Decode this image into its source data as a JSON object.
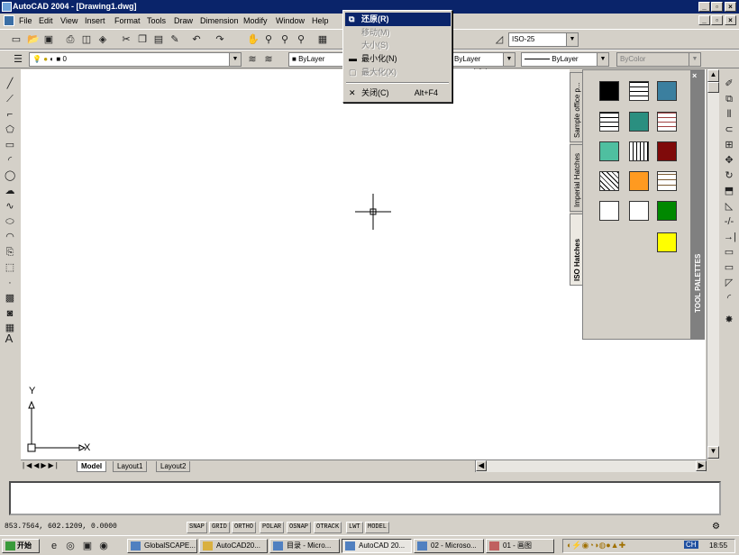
{
  "window": {
    "title": "AutoCAD 2004 - [Drawing1.dwg]"
  },
  "menubar": [
    "File",
    "Edit",
    "View",
    "Insert",
    "Format",
    "Tools",
    "Draw",
    "Dimension",
    "Modify",
    "Window",
    "Help"
  ],
  "toolbar": {
    "dimstyle_value": "ISO-25",
    "layer_value": "0",
    "color_value": "ByLayer",
    "linetype_value": "ByLayer",
    "lineweight_value": "ByLayer",
    "plotstyle_value": "ByColor"
  },
  "system_menu": {
    "items": [
      {
        "icon": "restore-icon",
        "label": "还原(R)",
        "shortcut": "",
        "state": "highlighted"
      },
      {
        "icon": "",
        "label": "移动(M)",
        "shortcut": "",
        "state": "disabled"
      },
      {
        "icon": "",
        "label": "大小(S)",
        "shortcut": "",
        "state": "disabled"
      },
      {
        "icon": "minimize-icon",
        "label": "最小化(N)",
        "shortcut": "",
        "state": "normal"
      },
      {
        "icon": "maximize-icon",
        "label": "最大化(X)",
        "shortcut": "",
        "state": "disabled"
      },
      {
        "icon": "close-icon",
        "label": "关闭(C)",
        "shortcut": "Alt+F4",
        "state": "normal"
      }
    ]
  },
  "tool_palette": {
    "title": "TOOL PALETTES",
    "tabs": [
      "Sample office p...",
      "Imperial Hatches",
      "ISO Hatches"
    ],
    "active_tab": "ISO Hatches",
    "swatch_colors": [
      "#000000",
      "#3b7f9f",
      "#2a8f80",
      "#4fbfa0",
      "#7f0a0a",
      "#ff9a20",
      "#008800",
      "#ffff00"
    ]
  },
  "layout_tabs": [
    "Model",
    "Layout1",
    "Layout2"
  ],
  "ucs": {
    "x_label": "X",
    "y_label": "Y"
  },
  "status": {
    "coords": "853.7564,  602.1209, 0.0000",
    "toggles": [
      "SNAP",
      "GRID",
      "ORTHO",
      "POLAR",
      "OSNAP",
      "OTRACK",
      "LWT",
      "MODEL"
    ]
  },
  "taskbar": {
    "start_label": "开始",
    "tasks": [
      {
        "label": "GlobalSCAPE...",
        "active": false
      },
      {
        "label": "AutoCAD20...",
        "active": false
      },
      {
        "label": "目录 - Micro...",
        "active": false
      },
      {
        "label": "AutoCAD 20...",
        "active": true
      },
      {
        "label": "02 - Microso...",
        "active": false
      },
      {
        "label": "01 - 画图",
        "active": false
      }
    ],
    "lang": "CH",
    "clock": "18:55"
  }
}
